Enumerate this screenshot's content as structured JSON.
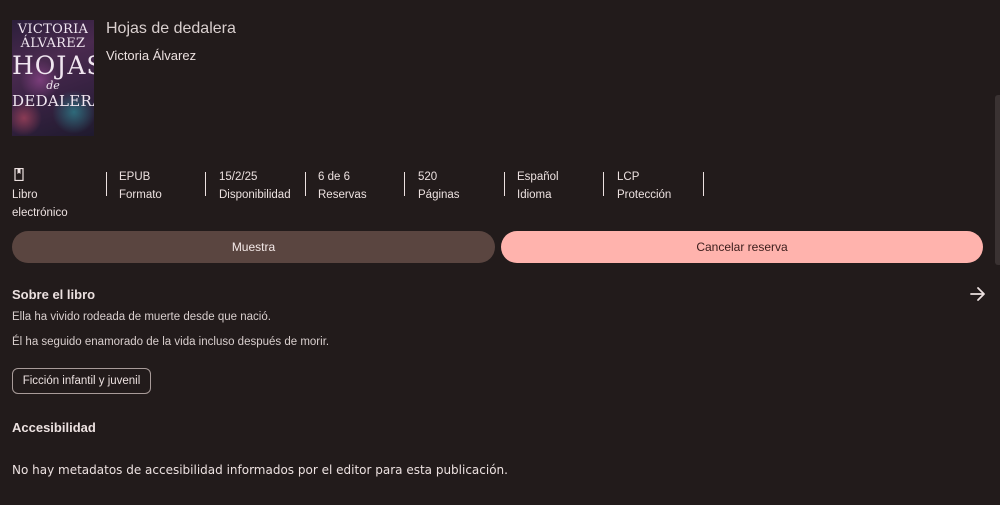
{
  "book": {
    "cover_lines": [
      "VICTORIA",
      "ÁLVAREZ",
      "HOJAS",
      "de",
      "DEDALERA"
    ],
    "title": "Hojas de dedalera",
    "author": "Victoria Álvarez"
  },
  "meta": [
    {
      "value": "",
      "label": "Libro electrónico",
      "icon": "book-icon"
    },
    {
      "value": "EPUB",
      "label": "Formato"
    },
    {
      "value": "15/2/25",
      "label": "Disponibilidad"
    },
    {
      "value": "6 de 6",
      "label": "Reservas"
    },
    {
      "value": "520",
      "label": "Páginas"
    },
    {
      "value": "Español",
      "label": "Idioma"
    },
    {
      "value": "LCP",
      "label": "Protección"
    }
  ],
  "buttons": {
    "sample": "Muestra",
    "cancel": "Cancelar reserva"
  },
  "about": {
    "title": "Sobre el libro",
    "lines": [
      "Ella ha vivido rodeada de muerte desde que nació.",
      "Él ha seguido enamorado de la vida incluso después de morir."
    ],
    "genre": "Ficción infantil y juvenil",
    "arrow_icon": "arrow-right-icon"
  },
  "accessibility": {
    "title": "Accesibilidad",
    "text": "No hay metadatos de accesibilidad informados por el editor para esta publicación."
  }
}
